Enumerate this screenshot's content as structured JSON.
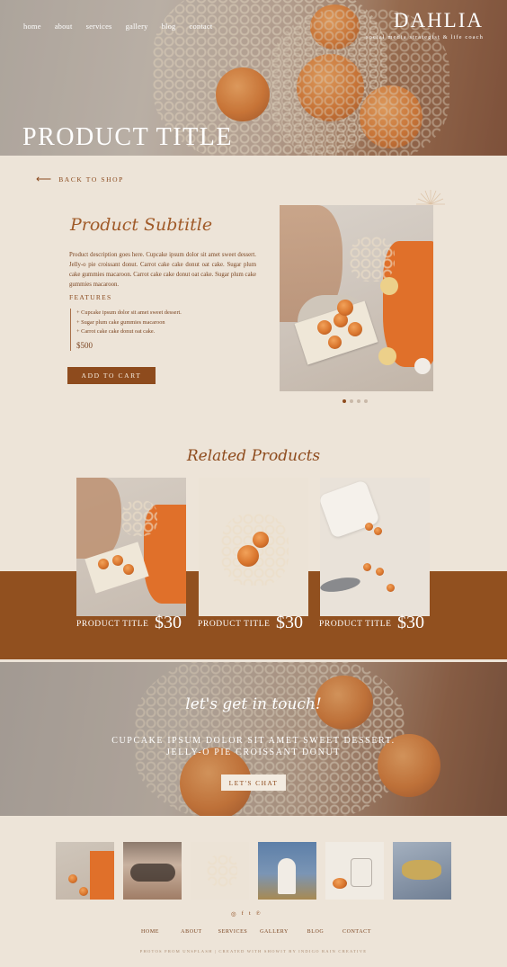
{
  "nav": {
    "items": [
      "home",
      "about",
      "services",
      "gallery",
      "blog",
      "contact"
    ]
  },
  "brand": {
    "name": "DAHLIA",
    "tagline": "social media strategist & life coach"
  },
  "hero": {
    "title": "PRODUCT TITLE"
  },
  "product": {
    "back_label": "BACK TO SHOP",
    "subtitle": "Product Subtitle",
    "description": "Product description goes here. Cupcake ipsum dolor sit amet sweet dessert. Jelly-o pie croissant donut. Carrot cake cake donut oat cake. Sugar plum cake gummies macaroon. Carrot cake cake donut oat cake. Sugar plum cake gummies macaroon.",
    "features_heading": "FEATURES",
    "features": [
      "+ Cupcake ipsum dolor sit amet sweet dessert.",
      "+ Sugar plum cake gummies macaroon",
      "+ Carrot cake cake donut oat cake."
    ],
    "price": "$500",
    "cart_label": "ADD TO CART",
    "carousel_active": 0,
    "carousel_count": 4
  },
  "related": {
    "heading": "Related Products",
    "items": [
      {
        "title": "PRODUCT TITLE",
        "price": "$30"
      },
      {
        "title": "PRODUCT TITLE",
        "price": "$30"
      },
      {
        "title": "PRODUCT TITLE",
        "price": "$30"
      }
    ]
  },
  "contact": {
    "heading": "let's get in touch!",
    "line1": "CUPCAKE IPSUM DOLOR SIT AMET SWEET DESSERT.",
    "line2": "JELLY-O PIE CROISSANT DONUT",
    "button": "LET'S CHAT"
  },
  "footer": {
    "social": [
      "instagram-icon",
      "facebook-icon",
      "twitter-icon",
      "pinterest-icon"
    ],
    "social_glyphs": [
      "◎",
      "f",
      "t",
      "℗"
    ],
    "nav": [
      "HOME",
      "ABOUT",
      "SERVICES",
      "GALLERY",
      "BLOG",
      "CONTACT"
    ],
    "credit": "PHOTOS FROM UNSPLASH | CREATED WITH SHOWIT BY INDIGO RAIN CREATIVE"
  },
  "colors": {
    "accent": "#8e4b1d",
    "background": "#ede4d8",
    "band": "#91501f"
  }
}
